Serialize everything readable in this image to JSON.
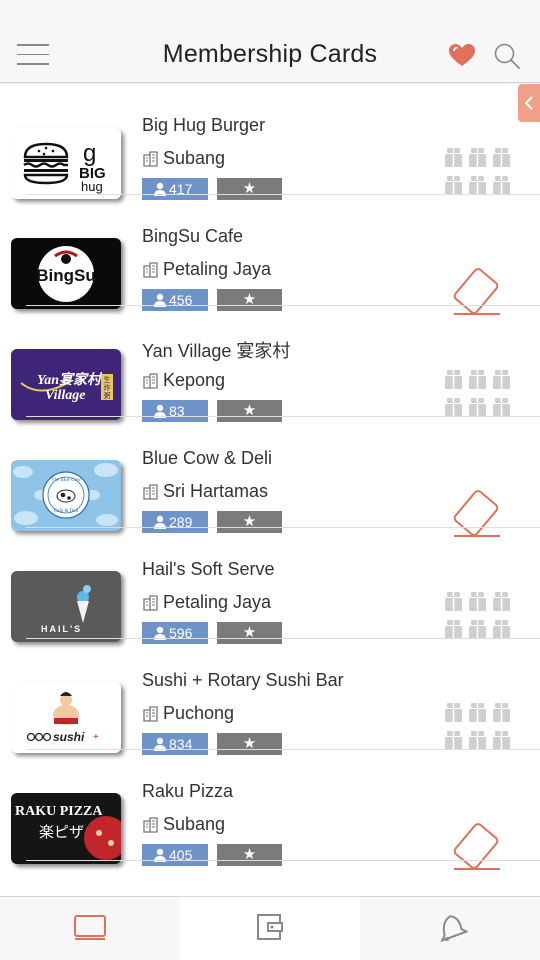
{
  "header": {
    "title": "Membership Cards"
  },
  "colors": {
    "accent": "#e0705a",
    "badge_blue": "#6d93c9",
    "badge_gray": "#7b7b7b"
  },
  "icons": {
    "menu": "hamburger-icon",
    "favorite": "heart-icon",
    "search": "search-icon",
    "location": "building-icon",
    "members": "user-icon",
    "rating": "star-icon",
    "grid": "gift-grid-icon",
    "card": "card-icon"
  },
  "cards": [
    {
      "name": "Big Hug Burger",
      "location": "Subang",
      "count": "417",
      "star": "★",
      "status": "grid"
    },
    {
      "name": "BingSu Cafe",
      "location": "Petaling Jaya",
      "count": "456",
      "star": "★",
      "status": "card"
    },
    {
      "name": "Yan Village 宴家村",
      "location": "Kepong",
      "count": "83",
      "star": "★",
      "status": "grid"
    },
    {
      "name": "Blue Cow & Deli",
      "location": "Sri Hartamas",
      "count": "289",
      "star": "★",
      "status": "card"
    },
    {
      "name": "Hail's Soft Serve",
      "location": "Petaling Jaya",
      "count": "596",
      "star": "★",
      "status": "grid"
    },
    {
      "name": "Sushi + Rotary Sushi Bar",
      "location": "Puchong",
      "count": "834",
      "star": "★",
      "status": "grid"
    },
    {
      "name": "Raku Pizza",
      "location": "Subang",
      "count": "405",
      "star": "★",
      "status": "card"
    },
    {
      "name": "",
      "location": "",
      "count": "",
      "star": "",
      "status": ""
    }
  ],
  "logos": {
    "bighug": "BIG hug",
    "bingsu": "BingSu",
    "yan": "Yan宴家村 Village",
    "yan_tag": "生炸粥",
    "bluecow": "The Blue Cow Cafe & Deli",
    "hails": "HAIL'S",
    "sushi": "sushi",
    "raku": "RAKU PIZZA",
    "raku_jp": "楽ピザ"
  },
  "tabs": [
    {
      "name": "cards"
    },
    {
      "name": "wallet"
    },
    {
      "name": "notifications"
    }
  ]
}
